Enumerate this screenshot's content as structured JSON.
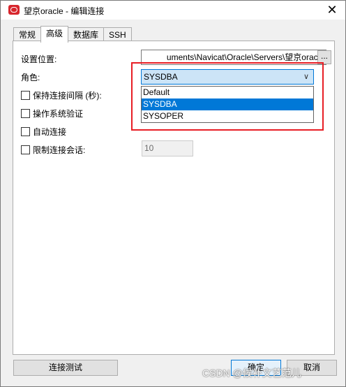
{
  "window": {
    "title": "望京oracle - 编辑连接",
    "close_glyph": "✕"
  },
  "tabs": [
    {
      "label": "常规",
      "active": false
    },
    {
      "label": "高级",
      "active": true
    },
    {
      "label": "数据库",
      "active": false
    },
    {
      "label": "SSH",
      "active": false
    }
  ],
  "form": {
    "location_label": "设置位置:",
    "location_value": "uments\\Navicat\\Oracle\\Servers\\望京oracle",
    "browse_label": "...",
    "role_label": "角色:",
    "role_selected": "SYSDBA",
    "role_options": [
      "Default",
      "SYSDBA",
      "SYSOPER"
    ],
    "keepalive_label": "保持连接间隔 (秒):",
    "os_auth_label": "操作系统验证",
    "auto_connect_label": "自动连接",
    "limit_sessions_label": "限制连接会话:",
    "limit_sessions_value": "10"
  },
  "footer": {
    "test_button": "连接测试",
    "ok_button": "确定",
    "cancel_button": "取消"
  },
  "watermark": "CSDN @候补文艺范儿",
  "colors": {
    "accent": "#0078d7",
    "highlight": "#e81e25",
    "app_icon": "#d7262d"
  }
}
